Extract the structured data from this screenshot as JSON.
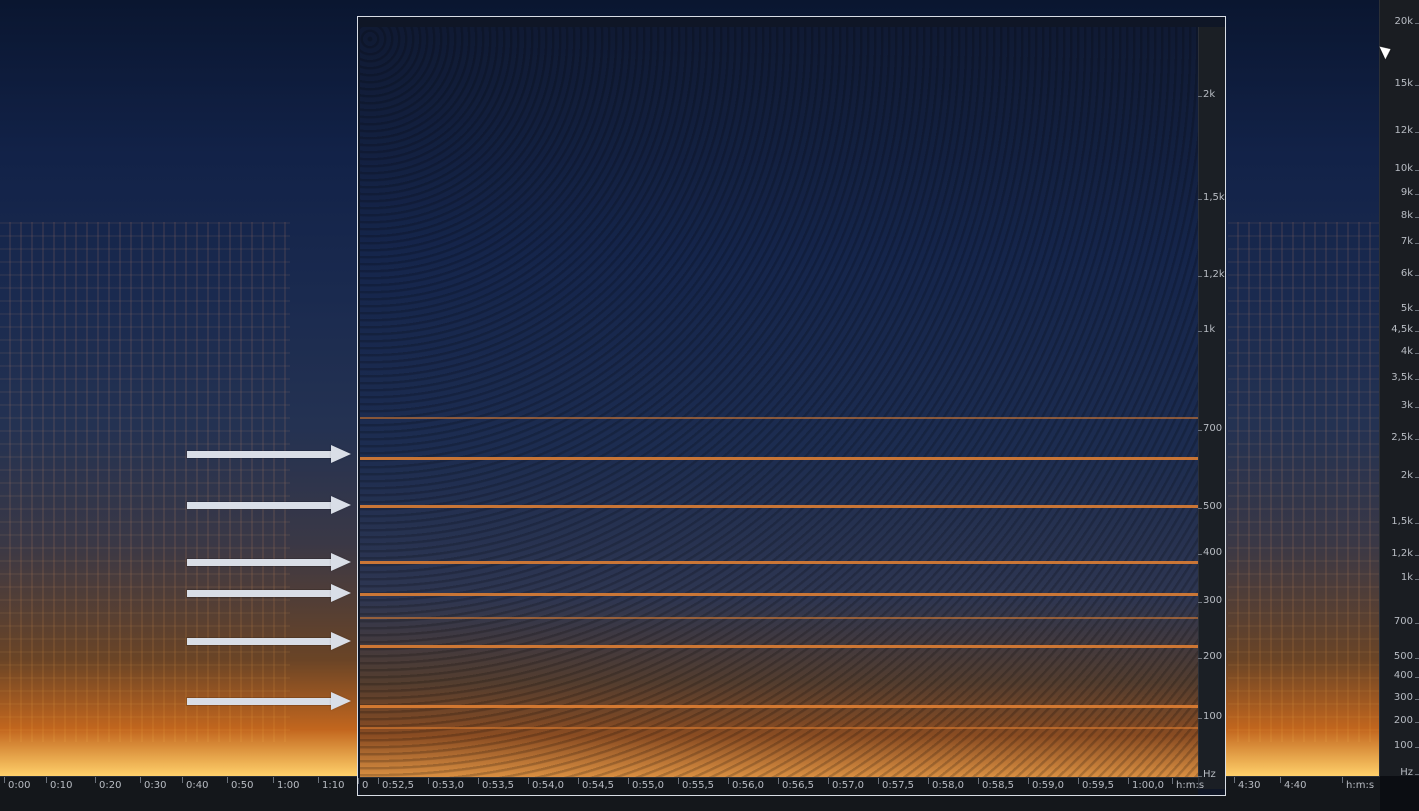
{
  "spectrogram": {
    "main_freq_axis_labels": [
      "20k",
      "15k",
      "12k",
      "10k",
      "9k",
      "8k",
      "7k",
      "6k",
      "5k",
      "4,5k",
      "4k",
      "3,5k",
      "3k",
      "2,5k",
      "2k",
      "1,5k",
      "1,2k",
      "1k",
      "700",
      "500",
      "400",
      "300",
      "200",
      "100",
      "Hz"
    ],
    "main_time_axis_labels": [
      "0:00",
      "0:10",
      "0:20",
      "0:30",
      "0:40",
      "0:50",
      "1:00",
      "1:10",
      "4:30",
      "4:40",
      "h:m:s"
    ],
    "zoom": {
      "freq_axis_labels": [
        "2k",
        "1,5k",
        "1,2k",
        "1k",
        "700",
        "500",
        "400",
        "300",
        "200",
        "100",
        "Hz"
      ],
      "time_axis_labels": [
        "0",
        "0:52,5",
        "0:53,0",
        "0:53,5",
        "0:54,0",
        "0:54,5",
        "0:55,0",
        "0:55,5",
        "0:56,0",
        "0:56,5",
        "0:57,0",
        "0:57,5",
        "0:58,0",
        "0:58,5",
        "0:59,0",
        "0:59,5",
        "1:00,0",
        "h:m:s"
      ]
    },
    "annotations": {
      "arrows_count": 6
    }
  }
}
